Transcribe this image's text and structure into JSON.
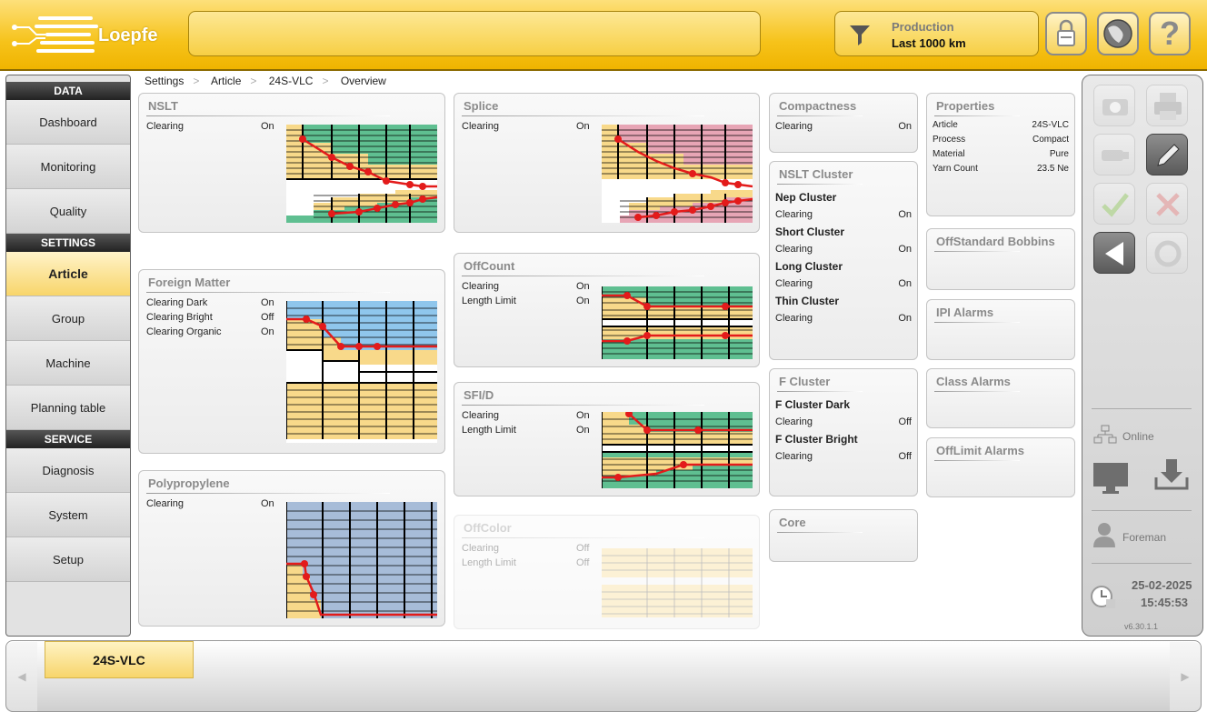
{
  "header": {
    "logo_text": "Loepfe",
    "production_label": "Production",
    "production_value": "Last 1000 km",
    "lock_icon": "lock-icon",
    "globe_icon": "globe-icon",
    "help_label": "?"
  },
  "nav": {
    "data_header": "DATA",
    "settings_header": "SETTINGS",
    "service_header": "SERVICE",
    "data_items": [
      "Dashboard",
      "Monitoring",
      "Quality"
    ],
    "settings_items": [
      "Article",
      "Group",
      "Machine",
      "Planning table"
    ],
    "service_items": [
      "Diagnosis",
      "System",
      "Setup"
    ],
    "selected": "Article"
  },
  "breadcrumb": [
    "Settings",
    "Article",
    "24S-VLC",
    "Overview"
  ],
  "panels": {
    "nslt": {
      "title": "NSLT",
      "rows": [
        [
          "Clearing",
          "On"
        ]
      ]
    },
    "splice": {
      "title": "Splice",
      "rows": [
        [
          "Clearing",
          "On"
        ]
      ]
    },
    "foreign": {
      "title": "Foreign Matter",
      "rows": [
        [
          "Clearing Dark",
          "On"
        ],
        [
          "Clearing Bright",
          "Off"
        ],
        [
          "Clearing Organic",
          "On"
        ]
      ]
    },
    "offcount": {
      "title": "OffCount",
      "rows": [
        [
          "Clearing",
          "On"
        ],
        [
          "Length Limit",
          "On"
        ]
      ]
    },
    "sfid": {
      "title": "SFI/D",
      "rows": [
        [
          "Clearing",
          "On"
        ],
        [
          "Length Limit",
          "On"
        ]
      ]
    },
    "poly": {
      "title": "Polypropylene",
      "rows": [
        [
          "Clearing",
          "On"
        ]
      ]
    },
    "offcolor": {
      "title": "OffColor",
      "rows": [
        [
          "Clearing",
          "Off"
        ],
        [
          "Length Limit",
          "Off"
        ]
      ]
    },
    "compactness": {
      "title": "Compactness",
      "rows": [
        [
          "Clearing",
          "On"
        ]
      ]
    },
    "nslt_cluster": {
      "title": "NSLT Cluster",
      "groups": [
        {
          "name": "Nep Cluster",
          "label": "Clearing",
          "value": "On"
        },
        {
          "name": "Short Cluster",
          "label": "Clearing",
          "value": "On"
        },
        {
          "name": "Long Cluster",
          "label": "Clearing",
          "value": "On"
        },
        {
          "name": "Thin Cluster",
          "label": "Clearing",
          "value": "On"
        }
      ]
    },
    "f_cluster": {
      "title": "F Cluster",
      "groups": [
        {
          "name": "F Cluster Dark",
          "label": "Clearing",
          "value": "Off"
        },
        {
          "name": "F Cluster Bright",
          "label": "Clearing",
          "value": "Off"
        }
      ]
    },
    "core": {
      "title": "Core"
    },
    "properties": {
      "title": "Properties",
      "rows": [
        [
          "Article",
          "24S-VLC"
        ],
        [
          "Process",
          "Compact"
        ],
        [
          "Material",
          "Pure"
        ],
        [
          "Yarn Count",
          "23.5 Ne"
        ]
      ]
    },
    "offstandard": {
      "title": "OffStandard Bobbins"
    },
    "ipi": {
      "title": "IPI Alarms"
    },
    "class": {
      "title": "Class Alarms"
    },
    "offlimit": {
      "title": "OffLimit Alarms"
    }
  },
  "right": {
    "online_label": "Online",
    "user_label": "Foreman",
    "date": "25-02-2025",
    "time": "15:45:53",
    "version": "v6.30.1.1"
  },
  "bottom": {
    "tab_label": "24S-VLC"
  },
  "colors": {
    "accent": "#f6c31b",
    "green": "#5fbf91",
    "pink": "#e7a5b5",
    "blue": "#8fc6ec",
    "steel": "#a7bcd8",
    "cream": "#f8d98a",
    "red": "#e31b1b"
  }
}
